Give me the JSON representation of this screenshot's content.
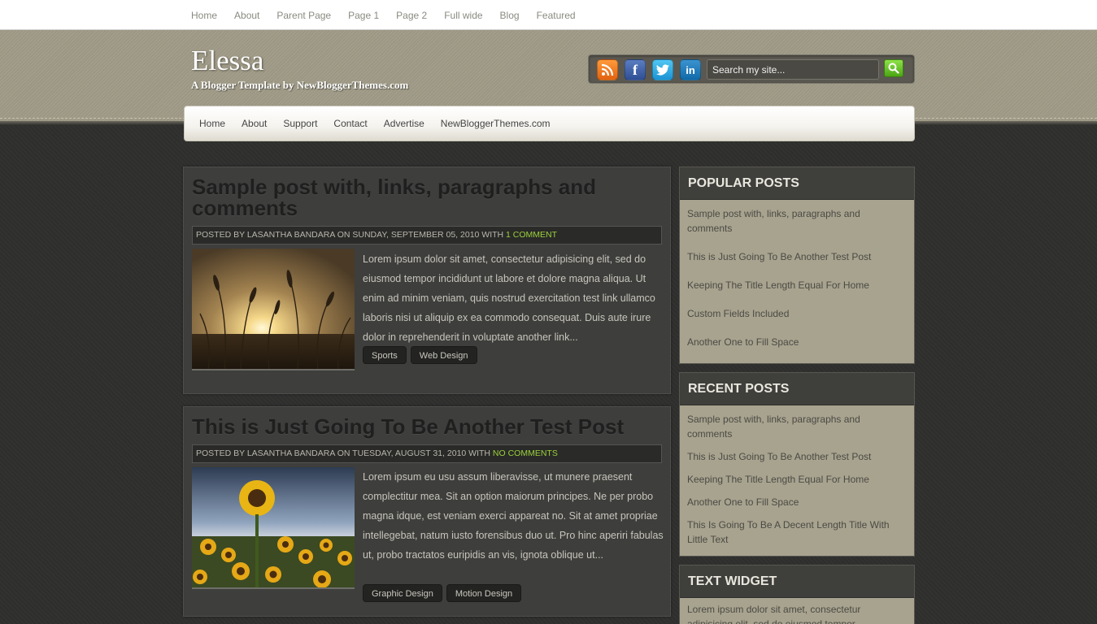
{
  "topnav": {
    "items": [
      "Home",
      "About",
      "Parent Page",
      "Page 1",
      "Page 2",
      "Full wide",
      "Blog",
      "Featured"
    ]
  },
  "header": {
    "title": "Elessa",
    "description": "A Blogger Template by NewBloggerThemes.com",
    "search_placeholder": "Search my site..."
  },
  "mainnav": {
    "items": [
      "Home",
      "About",
      "Support",
      "Contact",
      "Advertise",
      "NewBloggerThemes.com"
    ]
  },
  "posts": [
    {
      "title": "Sample post with, links, paragraphs and comments",
      "meta": "Posted by Lasantha Bandara on Sunday, September 05, 2010 with ",
      "comments": "1 comment",
      "body": "Lorem ipsum dolor sit amet, consectetur adipisicing elit, sed do eiusmod tempor incididunt ut labore et dolore magna aliqua. Ut enim ad minim veniam, quis nostrud exercitation test link ullamco laboris nisi ut aliquip ex ea commodo consequat. Duis aute irure dolor in reprehenderit in voluptate another link...",
      "tags": [
        "Sports",
        "Web Design"
      ]
    },
    {
      "title": "This is Just Going To Be Another Test Post",
      "meta": "Posted by Lasantha Bandara on Tuesday, August 31, 2010 with ",
      "comments": "No comments",
      "body": "Lorem ipsum eu usu assum liberavisse, ut munere praesent complectitur mea. Sit an option maiorum principes. Ne per probo magna idque, est veniam exerci appareat no. Sit at amet propriae intellegebat, natum iusto forensibus duo ut. Pro hinc aperiri fabulas ut, probo tractatos euripidis an vis, ignota oblique ut...",
      "tags": [
        "Graphic Design",
        "Motion Design"
      ]
    }
  ],
  "sidebar": {
    "popular": {
      "heading": "Popular Posts",
      "items": [
        "Sample post with, links, paragraphs and comments",
        "This is Just Going To Be Another Test Post",
        "Keeping The Title Length Equal For Home",
        "Custom Fields Included",
        "Another One to Fill Space"
      ]
    },
    "recent": {
      "heading": "Recent Posts",
      "items": [
        "Sample post with, links, paragraphs and comments",
        "This is Just Going To Be Another Test Post",
        "Keeping The Title Length Equal For Home",
        "Another One to Fill Space",
        "This Is Going To Be A Decent Length Title With Little Text"
      ]
    },
    "text_widget": {
      "heading": "Text Widget",
      "body": "Lorem ipsum dolor sit amet, consectetur adipisicing elit, sed do eiusmod tempor"
    }
  },
  "icons": [
    "rss-icon",
    "facebook-icon",
    "twitter-icon",
    "linkedin-icon",
    "search-icon"
  ],
  "colors": {
    "accent_green": "#9ad13b",
    "header_bg": "#a19c88",
    "body_bg": "#2f2f2e"
  }
}
